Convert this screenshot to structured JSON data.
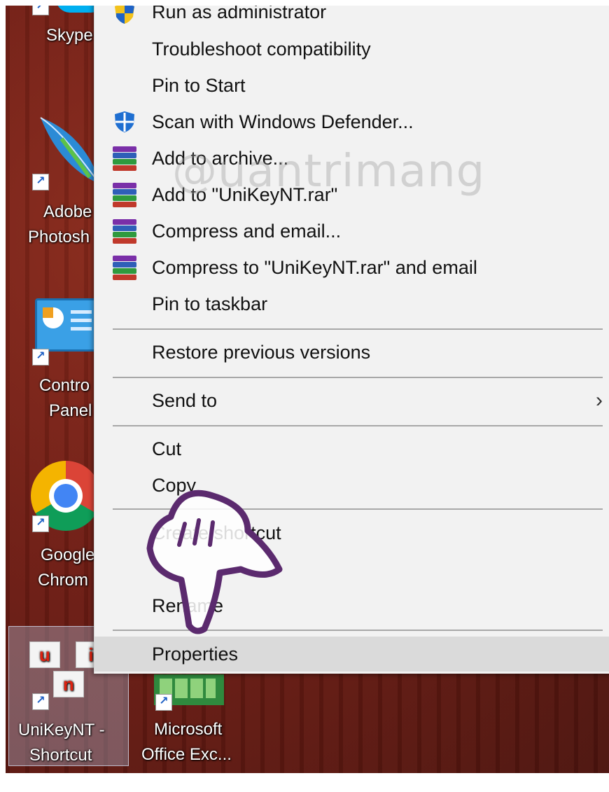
{
  "desktop": {
    "icons": [
      {
        "name": "skype",
        "label_lines": [
          "Skype"
        ]
      },
      {
        "name": "photoshop",
        "label_lines": [
          "Adobe",
          "Photosh"
        ]
      },
      {
        "name": "control-panel",
        "label_lines": [
          "Contro",
          "Panel"
        ]
      },
      {
        "name": "chrome",
        "label_lines": [
          "Google",
          "Chrom"
        ]
      },
      {
        "name": "unikey",
        "label_lines": [
          "UniKeyNT -",
          "Shortcut"
        ]
      },
      {
        "name": "excel",
        "label_lines": [
          "Microsoft",
          "Office Exc..."
        ]
      }
    ],
    "unikey_letters": [
      "u",
      "i",
      "n"
    ]
  },
  "menu": {
    "items": [
      {
        "label": "Run as administrator",
        "icon": "uac-shield-icon"
      },
      {
        "label": "Troubleshoot compatibility"
      },
      {
        "label": "Pin to Start"
      },
      {
        "label": "Scan with Windows Defender...",
        "icon": "defender-icon"
      },
      {
        "label": "Add to archive...",
        "icon": "winrar-icon"
      },
      {
        "label": "Add to \"UniKeyNT.rar\"",
        "icon": "winrar-icon"
      },
      {
        "label": "Compress and email...",
        "icon": "winrar-icon"
      },
      {
        "label": "Compress to \"UniKeyNT.rar\" and email",
        "icon": "winrar-icon"
      },
      {
        "label": "Pin to taskbar"
      },
      {
        "label": "Restore previous versions"
      },
      {
        "label": "Send to",
        "submenu": true
      },
      {
        "label": "Cut"
      },
      {
        "label": "Copy"
      },
      {
        "label": "Create shortcut"
      },
      {
        "label": "Rename"
      },
      {
        "label": "Properties",
        "highlighted": true
      }
    ]
  },
  "watermark": "@uantrimang",
  "colors": {
    "menu_bg": "#f2f2f2",
    "highlight": "#dadada",
    "defender_blue": "#1f6fd1",
    "wallpaper": "#6e1d14"
  }
}
